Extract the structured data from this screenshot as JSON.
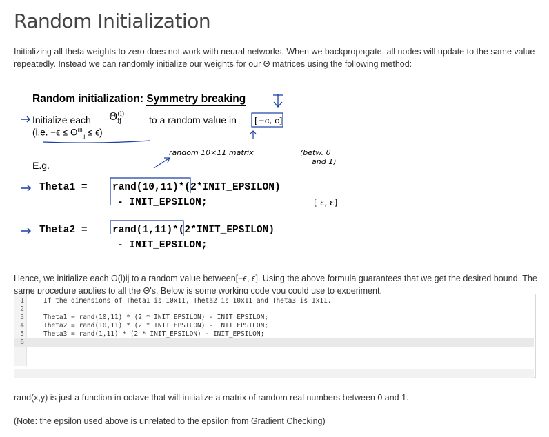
{
  "page": {
    "title": "Random Initialization",
    "intro": "Initializing all theta weights to zero does not work with neural networks. When we backpropagate, all nodes will update to the same value repeatedly. Instead we can randomly initialize our weights for our Θ matrices using the following method:",
    "hence": "Hence, we initialize each Θ(l)ij to a random value between[−ϵ, ϵ]. Using the above formula guarantees that we get the desired bound. The same procedure applies to all the Θ's. Below is some working code you could use to experiment.",
    "rand_note": "rand(x,y) is just a function in octave that will initialize a matrix of random real numbers between 0 and 1.",
    "epsilon_note": "(Note: the epsilon used above is unrelated to the epsilon from Gradient Checking)"
  },
  "slide": {
    "heading_part1": "Random initialization: ",
    "heading_part2": "Symmetry breaking",
    "init_line_1": "Initialize each",
    "init_line_2": "to a random value in",
    "init_line_3": "(i.e. −ϵ ≤ Θ",
    "init_line_4": "≤ ϵ)",
    "eg": "E.g.",
    "theta1_prefix": "Theta1 =",
    "theta1_code": "rand(10,11)*(2*INIT_EPSILON)",
    "theta1_code2": "- INIT_EPSILON;",
    "theta2_prefix": "Theta2 =",
    "theta2_code": "rand(1,11)*(2*INIT_EPSILON)",
    "theta2_code2": "- INIT_EPSILON;",
    "hand_random": "random  10×11  matrix",
    "hand_between": "(betw. 0",
    "hand_and": "and 1)",
    "hand_range": "[-ε, ε]"
  },
  "code": {
    "lines": [
      "If the dimensions of Theta1 is 10x11, Theta2 is 10x11 and Theta3 is 1x11.",
      "",
      "Theta1 = rand(10,11) * (2 * INIT_EPSILON) - INIT_EPSILON;",
      "Theta2 = rand(10,11) * (2 * INIT_EPSILON) - INIT_EPSILON;",
      "Theta3 = rand(1,11) * (2 * INIT_EPSILON) - INIT_EPSILON;",
      ""
    ],
    "numbers": [
      "1",
      "2",
      "3",
      "4",
      "5",
      "6"
    ]
  }
}
